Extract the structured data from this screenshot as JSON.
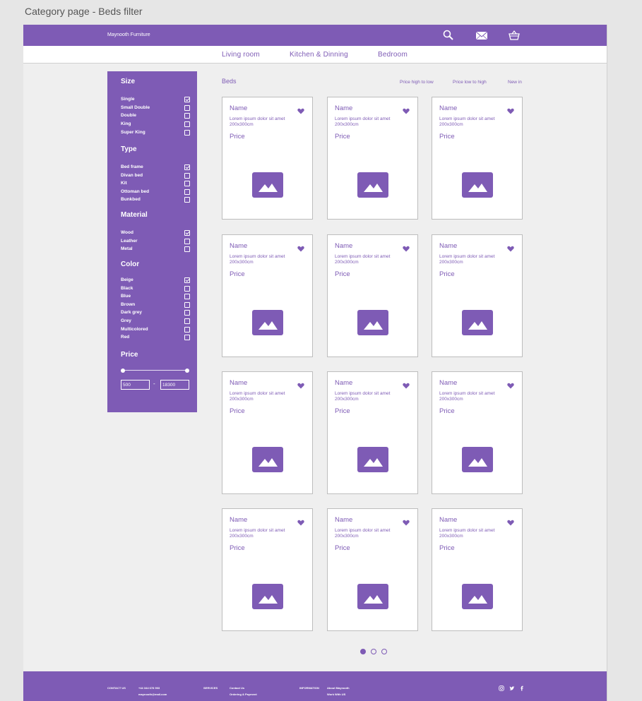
{
  "page_title": "Category page - Beds filter",
  "header": {
    "brand": "Maynooth Furniture",
    "icons": [
      "search-icon",
      "mail-icon",
      "basket-icon"
    ]
  },
  "nav": [
    {
      "label": "Living room"
    },
    {
      "label": "Kitchen & Dinning"
    },
    {
      "label": "Bedroom"
    }
  ],
  "filters": {
    "size": {
      "title": "Size",
      "options": [
        {
          "label": "Single",
          "checked": true
        },
        {
          "label": "Small Double",
          "checked": false
        },
        {
          "label": "Double",
          "checked": false
        },
        {
          "label": "King",
          "checked": false
        },
        {
          "label": "Super King",
          "checked": false
        }
      ]
    },
    "type": {
      "title": "Type",
      "options": [
        {
          "label": "Bed frame",
          "checked": true
        },
        {
          "label": "Divan bed",
          "checked": false
        },
        {
          "label": "Kit",
          "checked": false
        },
        {
          "label": "Ottoman bed",
          "checked": false
        },
        {
          "label": "Bunkbed",
          "checked": false
        }
      ]
    },
    "material": {
      "title": "Material",
      "options": [
        {
          "label": "Wood",
          "checked": true
        },
        {
          "label": "Leather",
          "checked": false
        },
        {
          "label": "Metal",
          "checked": false
        }
      ]
    },
    "color": {
      "title": "Color",
      "options": [
        {
          "label": "Beige",
          "checked": true
        },
        {
          "label": "Black",
          "checked": false
        },
        {
          "label": "Blue",
          "checked": false
        },
        {
          "label": "Brown",
          "checked": false
        },
        {
          "label": "Dark grey",
          "checked": false
        },
        {
          "label": "Grey",
          "checked": false
        },
        {
          "label": "Multicolored",
          "checked": false
        },
        {
          "label": "Red",
          "checked": false
        }
      ]
    },
    "price": {
      "title": "Price",
      "min": "500",
      "separator": "-",
      "max": "18300"
    }
  },
  "listing": {
    "title": "Beds",
    "sort": [
      "Price high to low",
      "Price low to high",
      "New in"
    ]
  },
  "product_card": {
    "name": "Name",
    "desc_line1": "Lorem ipsum dolor sit amet",
    "desc_line2": "200x300cm",
    "price": "Price"
  },
  "grid": {
    "rows": 4,
    "cols": 3
  },
  "pagination": {
    "pages": 3,
    "current": 1
  },
  "footer": {
    "contact_us": "CONTACT US",
    "phone": "+44 344 678 903",
    "email": "maynooth@mail.com",
    "services": "SERVICES",
    "contact_link": "Contact Us",
    "ordering": "Ordering & Payment",
    "information": "INFORMATION",
    "about": "About Maynooth",
    "work": "Work With US",
    "social": [
      "instagram-icon",
      "twitter-icon",
      "facebook-icon"
    ]
  },
  "colors": {
    "accent": "#7e5bb5",
    "background": "#efefef"
  }
}
